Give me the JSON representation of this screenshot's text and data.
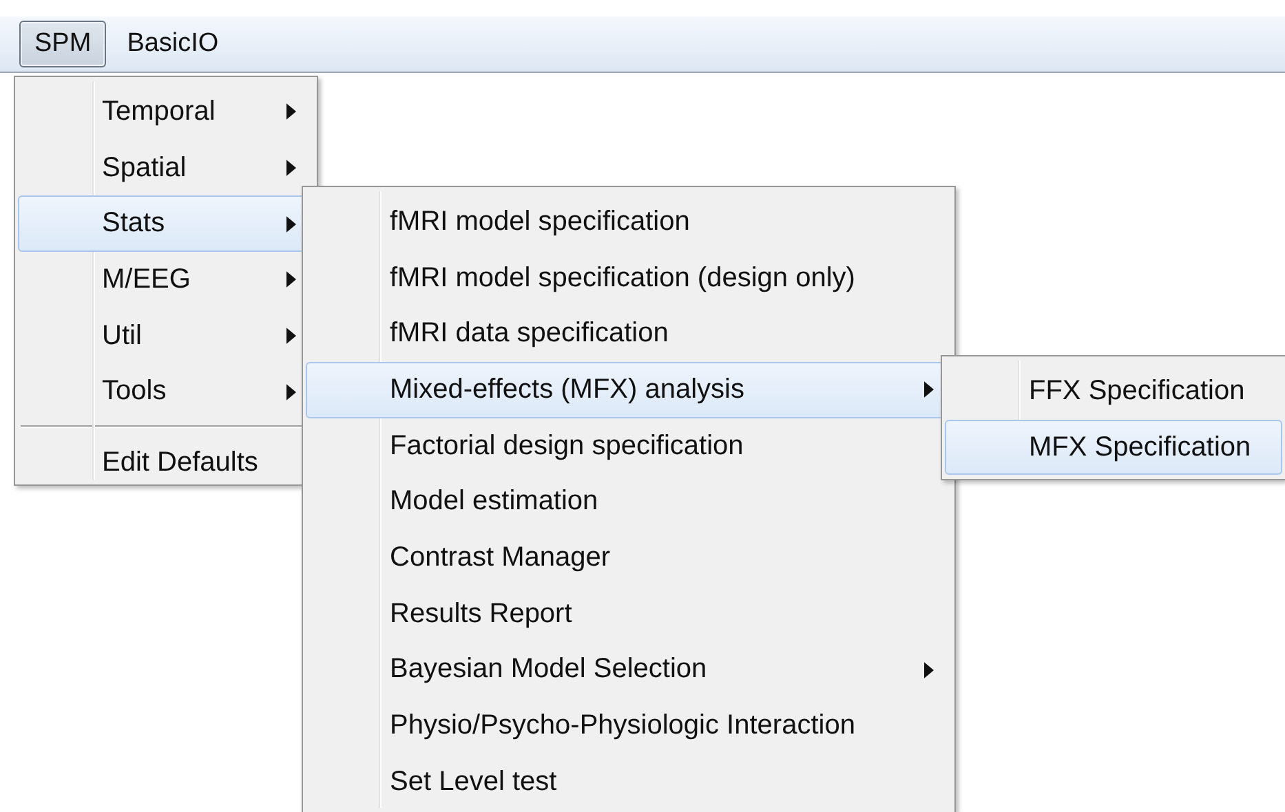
{
  "menubar": [
    {
      "label": "SPM",
      "selected": true
    },
    {
      "label": "BasicIO",
      "selected": false
    }
  ],
  "menus": [
    {
      "items": [
        {
          "kind": "item",
          "label": "Temporal",
          "submenu": true,
          "selected": false
        },
        {
          "kind": "item",
          "label": "Spatial",
          "submenu": true,
          "selected": false
        },
        {
          "kind": "item",
          "label": "Stats",
          "submenu": true,
          "selected": true
        },
        {
          "kind": "item",
          "label": "M/EEG",
          "submenu": true,
          "selected": false
        },
        {
          "kind": "item",
          "label": "Util",
          "submenu": true,
          "selected": false
        },
        {
          "kind": "item",
          "label": "Tools",
          "submenu": true,
          "selected": false
        },
        {
          "kind": "separator"
        },
        {
          "kind": "item",
          "label": "Edit Defaults",
          "submenu": false,
          "selected": false
        }
      ]
    },
    {
      "items": [
        {
          "kind": "item",
          "label": "fMRI model specification",
          "submenu": false,
          "selected": false
        },
        {
          "kind": "item",
          "label": "fMRI model specification (design only)",
          "submenu": false,
          "selected": false
        },
        {
          "kind": "item",
          "label": "fMRI data specification",
          "submenu": false,
          "selected": false
        },
        {
          "kind": "item",
          "label": "Mixed-effects (MFX) analysis",
          "submenu": true,
          "selected": true
        },
        {
          "kind": "item",
          "label": "Factorial design specification",
          "submenu": false,
          "selected": false
        },
        {
          "kind": "item",
          "label": "Model estimation",
          "submenu": false,
          "selected": false
        },
        {
          "kind": "item",
          "label": "Contrast Manager",
          "submenu": false,
          "selected": false
        },
        {
          "kind": "item",
          "label": "Results Report",
          "submenu": false,
          "selected": false
        },
        {
          "kind": "item",
          "label": "Bayesian Model Selection",
          "submenu": true,
          "selected": false
        },
        {
          "kind": "item",
          "label": "Physio/Psycho-Physiologic Interaction",
          "submenu": false,
          "selected": false
        },
        {
          "kind": "item",
          "label": "Set Level test",
          "submenu": false,
          "selected": false
        }
      ]
    },
    {
      "items": [
        {
          "kind": "item",
          "label": "FFX Specification",
          "submenu": false,
          "selected": false
        },
        {
          "kind": "item",
          "label": "MFX Specification",
          "submenu": false,
          "selected": true
        }
      ]
    }
  ]
}
